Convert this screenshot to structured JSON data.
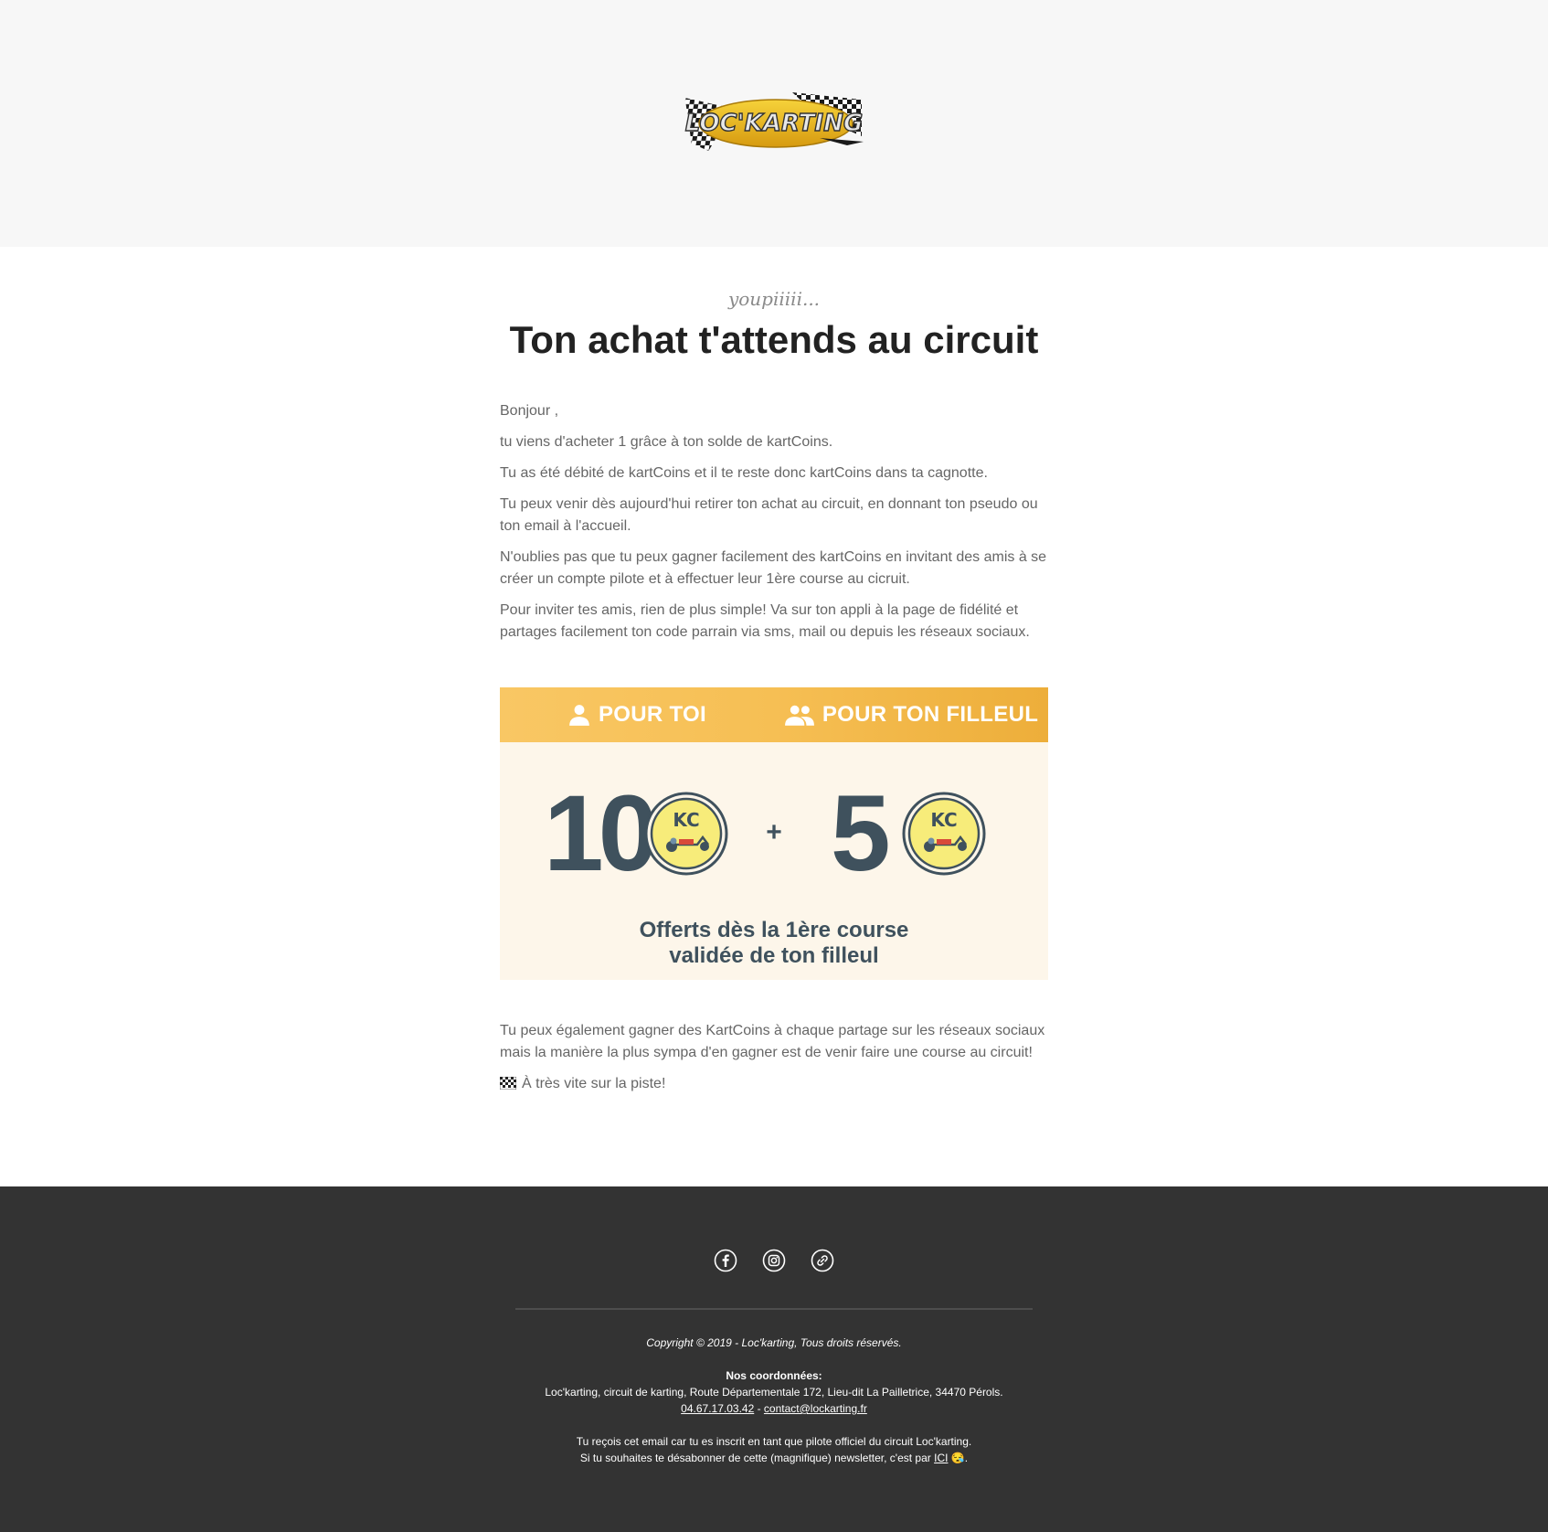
{
  "header": {
    "logo_text": "LOC'KARTING"
  },
  "hero": {
    "eyebrow": "youpiiiii...",
    "title": "Ton achat t'attends au circuit"
  },
  "body": {
    "greeting": "Bonjour ,",
    "p1": "tu viens d'acheter 1 grâce à ton solde de kartCoins.",
    "p2": "Tu as été débité de kartCoins et il te reste donc kartCoins dans ta cagnotte.",
    "p3": "Tu peux venir dès aujourd'hui retirer ton achat au circuit, en donnant ton pseudo ou ton email à l'accueil.",
    "p4": "N'oublies pas que tu peux gagner facilement des kartCoins en invitant des amis à se créer un compte pilote et à effectuer leur 1ère course au cicruit.",
    "p5": "Pour inviter tes amis, rien de plus simple! Va sur ton appli à la page de fidélité et partages facilement ton code parrain via sms, mail ou depuis les réseaux sociaux."
  },
  "promo": {
    "tab_you": "POUR TOI",
    "tab_referral": "POUR TON FILLEUL",
    "amount_you": "10",
    "amount_referral": "5",
    "coin_label": "KC",
    "plus": "+",
    "caption_line1": "Offerts dès la 1ère course",
    "caption_line2": "validée de ton filleul",
    "colors": {
      "header_start": "#f9c764",
      "header_end": "#edae3a",
      "body_bg": "#fdf6ea",
      "text": "#3f515d",
      "coin": "#f7ec7a"
    }
  },
  "after": {
    "p1": "Tu peux également gagner des KartCoins à chaque partage sur les réseaux sociaux mais la manière la plus sympa d'en gagner est de venir faire une course au circuit!",
    "p2": "À très vite sur la piste!"
  },
  "footer": {
    "social_icons": [
      "facebook-icon",
      "instagram-icon",
      "link-icon"
    ],
    "copyright": "Copyright © 2019 - Loc'karting, Tous droits réservés.",
    "contact_heading": "Nos coordonnées:",
    "address": "Loc'karting, circuit de karting, Route Départementale 172, Lieu-dit La Pailletrice, 34470 Pérols.",
    "phone": "04.67.17.03.42",
    "separator": " - ",
    "email": "contact@lockarting.fr",
    "notice_line1": "Tu reçois cet email car tu es inscrit en tant que pilote officiel du circuit Loc'karting.",
    "notice_line2_prefix": "Si tu souhaites te désabonner de cette (magnifique) newsletter, c'est par ",
    "unsubscribe_link": "ICI",
    "notice_line2_suffix": " 😪."
  }
}
